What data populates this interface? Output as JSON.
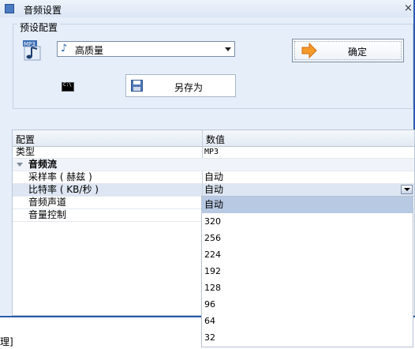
{
  "window": {
    "title": "音频设置"
  },
  "preset": {
    "group_label": "预设配置",
    "selected": "高质量",
    "confirm_label": "确定",
    "save_as_label": "另存为",
    "mp3_icon_text": "MP3",
    "cmd_icon_text": "C:\\"
  },
  "grid": {
    "headers": [
      "配置",
      "数值"
    ],
    "rows": [
      {
        "name": "类型",
        "value": "MP3"
      },
      {
        "category": "音频流"
      },
      {
        "name": "采样率 ( 赫兹 )",
        "value": "自动"
      },
      {
        "name": "比特率 ( KB/秒 )",
        "value": "自动"
      },
      {
        "name": "音频声道",
        "value": ""
      },
      {
        "name": "音量控制",
        "value": ""
      }
    ]
  },
  "dropdown": {
    "options": [
      "自动",
      "320",
      "256",
      "224",
      "192",
      "128",
      "96",
      "64",
      "32"
    ],
    "selected": "自动"
  },
  "status": {
    "text": "理]"
  },
  "colors": {
    "accent": "#2a5caa",
    "window_bg": "#e6eef9",
    "selection": "#b8c9e3"
  }
}
